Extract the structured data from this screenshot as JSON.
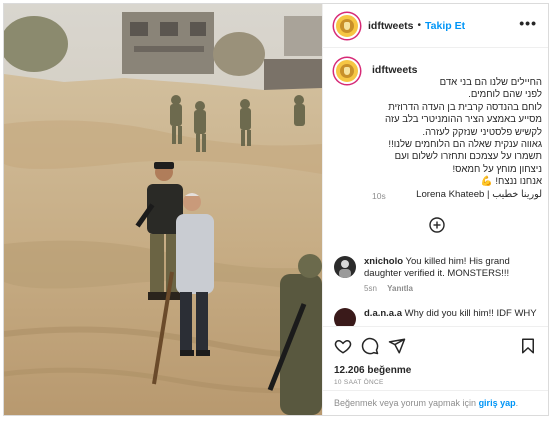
{
  "post": {
    "username": "idftweets",
    "follow_label": "Takip Et",
    "separator": "•",
    "more_label": "•••",
    "caption": {
      "lines": [
        "החיילים שלנו הם בני אדם",
        "לפני שהם לוחמים.",
        "לוחם בהנדסה קרבית בן העדה הדרוזית",
        "מסייע באמצע הציר ההומניטרי בלב עזה",
        "לקשיש פלסטיני שנזקק לעזרה.",
        "גאווה ענקית שאלה הם הלוחמים שלנו!!",
        "תשמרו על עצמכם ותחזרו לשלום ועם",
        "ניצחון מוחץ על חמאס!",
        "אנחנו ננצח! 💪",
        "لورينا خطيب | Lorena Khateeb"
      ],
      "time": "10s"
    },
    "comments": [
      {
        "user": "xnicholo",
        "text": "You killed him! His grand daughter verified it. MONSTERS!!!",
        "time": "5sn",
        "reply_label": "Yanıtla"
      },
      {
        "user": "d.a.n.a.a",
        "text": "Why did you kill him!! IDF WHY"
      }
    ],
    "likes": "12.206 beğenme",
    "time_ago": "10 SAAT ÖNCE",
    "login_prompt": {
      "prefix": "Beğenmek veya yorum yapmak için ",
      "link": "giriş yap",
      "suffix": "."
    }
  },
  "colors": {
    "link_blue": "#0095f6",
    "text_primary": "#262626",
    "text_secondary": "#8e8e8e",
    "border": "#dbdbdb"
  },
  "icons": [
    "avatar-logo-icon",
    "add-circle-icon",
    "heart-icon",
    "comment-icon",
    "share-icon",
    "bookmark-icon"
  ]
}
